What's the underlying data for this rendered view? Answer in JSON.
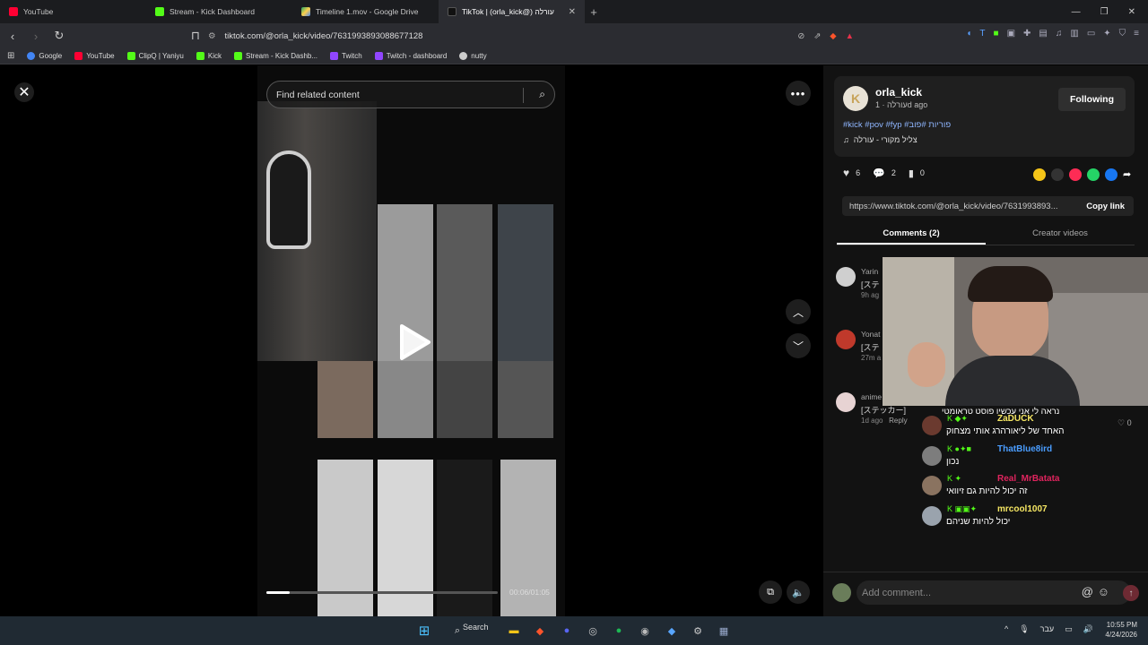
{
  "browser": {
    "tabs": [
      {
        "label": "YouTube",
        "color": "#ff0033"
      },
      {
        "label": "Stream - Kick Dashboard",
        "color": "#53fc18"
      },
      {
        "label": "Timeline 1.mov - Google Drive",
        "color": "#1fa463"
      },
      {
        "label": "TikTok | (orla_kick@) עורלה",
        "color": "#ffffff",
        "active": true
      }
    ],
    "url": "tiktok.com/@orla_kick/video/7631993893088677128",
    "bookmarks": [
      {
        "label": "Google",
        "color": "#4285f4"
      },
      {
        "label": "YouTube",
        "color": "#ff0033"
      },
      {
        "label": "ClipQ | Yaniyu",
        "color": "#53fc18"
      },
      {
        "label": "Kick",
        "color": "#53fc18"
      },
      {
        "label": "Stream - Kick Dashb...",
        "color": "#53fc18"
      },
      {
        "label": "Twitch",
        "color": "#9146ff"
      },
      {
        "label": "Twitch - dashboard",
        "color": "#9146ff"
      },
      {
        "label": "nutty",
        "color": "#cccccc"
      }
    ]
  },
  "player": {
    "search_placeholder": "Find related content",
    "time": "00:06/01:05",
    "progress": 0.1
  },
  "post": {
    "username": "orla_kick",
    "subtitle": "עורלה · 1d ago",
    "follow_label": "Following",
    "hashtags": "#kick #pov #fyp #פוריות #פובּ",
    "sound": "צליל מקורי - עורלה",
    "likes": "6",
    "comments": "2",
    "saves": "0",
    "link": "https://www.tiktok.com/@orla_kick/video/7631993893...",
    "copy_label": "Copy link",
    "tab_comments": "Comments (2)",
    "tab_creator": "Creator videos"
  },
  "comments": [
    {
      "name": "Yarin",
      "text": "[ステ",
      "date": "9h ag",
      "color": "#cfcfcf"
    },
    {
      "name": "Yonat",
      "text": "[ステ",
      "date": "27m a",
      "color": "#c0392b"
    },
    {
      "name": "anime",
      "text": "[ステッカー]",
      "date": "1d ago",
      "reply": "Reply",
      "likes": "0",
      "color": "#e7d3d3"
    }
  ],
  "overlay_top": "נראה לי אני עכשיו פוסט טראומטי",
  "chat": [
    {
      "name": "ZaDUCK",
      "name_color": "#f5e663",
      "message": "האחד של ליאורהרג אותי מצחוק"
    },
    {
      "name": "ThatBlue8ird",
      "name_color": "#4a9dff",
      "message": "נכון"
    },
    {
      "name": "Real_MrBatata",
      "name_color": "#e0245e",
      "message": "זה יכול להיות גם זיוואי"
    },
    {
      "name": "mrcool1007",
      "name_color": "#f5e663",
      "message": "יכול להיות שניהם"
    }
  ],
  "add_comment_placeholder": "Add comment...",
  "taskbar": {
    "search": "Search",
    "lang": "עבר",
    "time": "10:55 PM",
    "date": "4/24/2026"
  }
}
